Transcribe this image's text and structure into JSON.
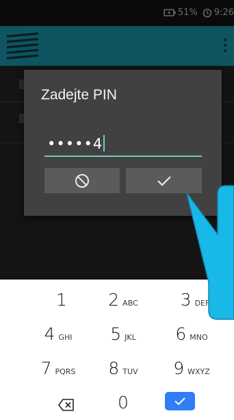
{
  "status_bar": {
    "battery_label": "51%",
    "time_label": "9:26",
    "battery_icon": "battery-charging-icon",
    "alarm_icon": "alarm-clock-icon"
  },
  "app_bar": {
    "logo_icon": "striped-logo-icon",
    "menu_icon": "overflow-menu-icon"
  },
  "dialog": {
    "title": "Zadejte PIN",
    "pin_value": "•••••4",
    "cancel_icon": "block-icon",
    "confirm_icon": "check-icon"
  },
  "keyboard": {
    "rows": [
      [
        {
          "num": "1",
          "letters": ""
        },
        {
          "num": "2",
          "letters": "ABC"
        },
        {
          "num": "3",
          "letters": "DEF"
        }
      ],
      [
        {
          "num": "4",
          "letters": "GHI"
        },
        {
          "num": "5",
          "letters": "JKL"
        },
        {
          "num": "6",
          "letters": "MNO"
        }
      ],
      [
        {
          "num": "7",
          "letters": "PQRS"
        },
        {
          "num": "8",
          "letters": "TUV"
        },
        {
          "num": "9",
          "letters": "WXYZ"
        }
      ]
    ],
    "zero": "0",
    "backspace_icon": "backspace-icon",
    "done_icon": "check-icon"
  },
  "colors": {
    "app_bar": "#0d5561",
    "accent": "#79c8c2",
    "dialog_bg": "#414141",
    "done_key": "#2f7ef3",
    "callout": "#18b8e8"
  }
}
